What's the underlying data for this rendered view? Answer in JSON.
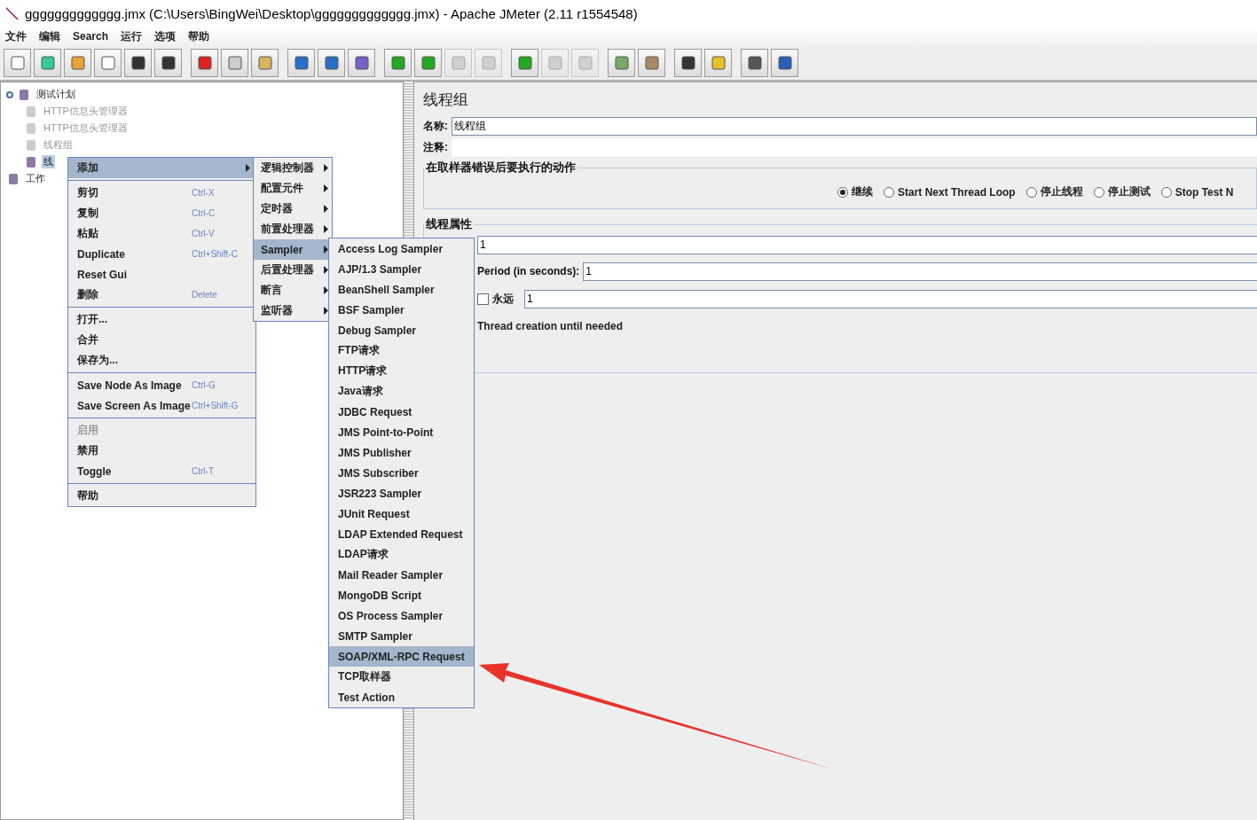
{
  "window": {
    "title": "ggggggggggggg.jmx (C:\\Users\\BingWei\\Desktop\\ggggggggggggg.jmx) - Apache JMeter (2.11 r1554548)"
  },
  "menu_bar": [
    "文件",
    "编辑",
    "Search",
    "运行",
    "选项",
    "帮助"
  ],
  "toolbar": [
    [
      {
        "disabled": false
      },
      {
        "disabled": false
      },
      {
        "disabled": false
      },
      {
        "disabled": false
      },
      {
        "disabled": false
      },
      {
        "disabled": false
      }
    ],
    [
      {
        "disabled": false
      },
      {
        "disabled": false
      },
      {
        "disabled": false
      }
    ],
    [
      {
        "disabled": false
      },
      {
        "disabled": false
      },
      {
        "disabled": false
      }
    ],
    [
      {
        "disabled": false
      },
      {
        "disabled": false
      },
      {
        "disabled": true
      },
      {
        "disabled": true
      }
    ],
    [
      {
        "disabled": false
      },
      {
        "disabled": true
      },
      {
        "disabled": true
      }
    ],
    [
      {
        "disabled": false
      },
      {
        "disabled": false
      }
    ],
    [
      {
        "disabled": false
      },
      {
        "disabled": false
      }
    ],
    [
      {
        "disabled": false
      },
      {
        "disabled": false
      }
    ]
  ],
  "tree": [
    {
      "label": "测试计划",
      "disabled": false,
      "selected": false,
      "children": [
        {
          "label": "HTTP信息头管理器",
          "disabled": true,
          "selected": false
        },
        {
          "label": "HTTP信息头管理器",
          "disabled": true,
          "selected": false
        },
        {
          "label": "线程组",
          "disabled": true,
          "selected": false
        },
        {
          "label": "线",
          "disabled": false,
          "selected": true
        }
      ]
    },
    {
      "label": "工作",
      "disabled": false,
      "selected": false
    }
  ],
  "context_menu": [
    [
      {
        "label": "添加",
        "submenu": true,
        "disabled": false,
        "selected": true
      }
    ],
    [
      {
        "label": "剪切",
        "shortcut": "Ctrl-X",
        "submenu": false,
        "disabled": false,
        "selected": false
      },
      {
        "label": "复制",
        "shortcut": "Ctrl-C",
        "submenu": false,
        "disabled": false,
        "selected": false
      },
      {
        "label": "粘贴",
        "shortcut": "Ctrl-V",
        "submenu": false,
        "disabled": false,
        "selected": false
      },
      {
        "label": "Duplicate",
        "shortcut": "Ctrl+Shift-C",
        "submenu": false,
        "disabled": false,
        "selected": false
      },
      {
        "label": "Reset Gui",
        "submenu": false,
        "disabled": false,
        "selected": false
      },
      {
        "label": "删除",
        "shortcut": "Delete",
        "submenu": false,
        "disabled": false,
        "selected": false
      }
    ],
    [
      {
        "label": "打开...",
        "submenu": false,
        "disabled": false,
        "selected": false
      },
      {
        "label": "合并",
        "submenu": false,
        "disabled": false,
        "selected": false
      },
      {
        "label": "保存为...",
        "submenu": false,
        "disabled": false,
        "selected": false
      }
    ],
    [
      {
        "label": "Save Node As Image",
        "shortcut": "Ctrl-G",
        "submenu": false,
        "disabled": false,
        "selected": false
      },
      {
        "label": "Save Screen As Image",
        "shortcut": "Ctrl+Shift-G",
        "submenu": false,
        "disabled": false,
        "selected": false
      }
    ],
    [
      {
        "label": "启用",
        "submenu": false,
        "disabled": true,
        "selected": false
      },
      {
        "label": "禁用",
        "submenu": false,
        "disabled": false,
        "selected": false
      },
      {
        "label": "Toggle",
        "shortcut": "Ctrl-T",
        "submenu": false,
        "disabled": false,
        "selected": false
      }
    ],
    [
      {
        "label": "帮助",
        "submenu": false,
        "disabled": false,
        "selected": false
      }
    ]
  ],
  "add_submenu": [
    {
      "label": "逻辑控制器",
      "selected": false
    },
    {
      "label": "配置元件",
      "selected": false
    },
    {
      "label": "定时器",
      "selected": false
    },
    {
      "label": "前置处理器",
      "selected": false
    },
    {
      "label": "Sampler",
      "selected": true
    },
    {
      "label": "后置处理器",
      "selected": false
    },
    {
      "label": "断言",
      "selected": false
    },
    {
      "label": "监听器",
      "selected": false
    }
  ],
  "sampler_submenu": [
    {
      "label": "Access Log Sampler",
      "selected": false
    },
    {
      "label": "AJP/1.3 Sampler",
      "selected": false
    },
    {
      "label": "BeanShell Sampler",
      "selected": false
    },
    {
      "label": "BSF Sampler",
      "selected": false
    },
    {
      "label": "Debug Sampler",
      "selected": false
    },
    {
      "label": "FTP请求",
      "selected": false
    },
    {
      "label": "HTTP请求",
      "selected": false
    },
    {
      "label": "Java请求",
      "selected": false
    },
    {
      "label": "JDBC Request",
      "selected": false
    },
    {
      "label": "JMS Point-to-Point",
      "selected": false
    },
    {
      "label": "JMS Publisher",
      "selected": false
    },
    {
      "label": "JMS Subscriber",
      "selected": false
    },
    {
      "label": "JSR223 Sampler",
      "selected": false
    },
    {
      "label": "JUnit Request",
      "selected": false
    },
    {
      "label": "LDAP Extended Request",
      "selected": false
    },
    {
      "label": "LDAP请求",
      "selected": false
    },
    {
      "label": "Mail Reader Sampler",
      "selected": false
    },
    {
      "label": "MongoDB Script",
      "selected": false
    },
    {
      "label": "OS Process Sampler",
      "selected": false
    },
    {
      "label": "SMTP Sampler",
      "selected": false
    },
    {
      "label": "SOAP/XML-RPC Request",
      "selected": true
    },
    {
      "label": "TCP取样器",
      "selected": false
    },
    {
      "label": "Test Action",
      "selected": false
    }
  ],
  "panel": {
    "title": "线程组",
    "name_label": "名称:",
    "name_value": "线程组",
    "comment_label": "注释:",
    "error_action": {
      "title": "在取样器错误后要执行的动作",
      "options": [
        {
          "label": "继续",
          "selected": true
        },
        {
          "label": "Start Next Thread Loop",
          "selected": false
        },
        {
          "label": "停止线程",
          "selected": false
        },
        {
          "label": "停止测试",
          "selected": false
        },
        {
          "label": "Stop Test N",
          "selected": false
        }
      ]
    },
    "thread_properties": {
      "title": "线程属性",
      "threads_value": "1",
      "period_label": "Period (in seconds):",
      "period_value": "1",
      "forever": {
        "label": "永远",
        "checked": false
      },
      "loop_value": "1",
      "delay_text": "Thread creation until needed"
    }
  }
}
